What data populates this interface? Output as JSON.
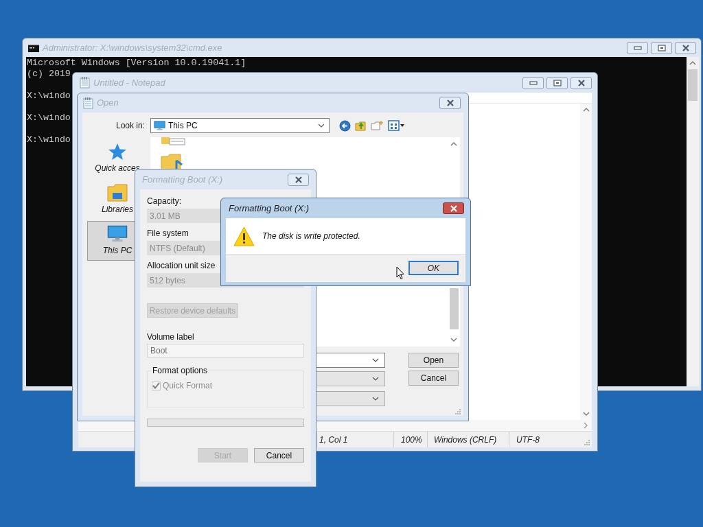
{
  "console_window": {
    "title": "Administrator: X:\\windows\\system32\\cmd.exe",
    "active": false,
    "lines": [
      {
        "kind": "output",
        "text": "Microsoft Windows [Version 10.0.19041.1]"
      },
      {
        "kind": "output",
        "text": "(c) 2019"
      },
      {
        "kind": "prompt",
        "text": "X:\\windo"
      },
      {
        "kind": "prompt",
        "text": "X:\\windo"
      },
      {
        "kind": "prompt",
        "text": "X:\\windo"
      }
    ]
  },
  "notepad_window": {
    "title": "Untitled - Notepad",
    "active": false,
    "status_bar": [
      "1, Col 1",
      "100%",
      "Windows (CRLF)",
      "UTF-8"
    ]
  },
  "open_dialog": {
    "title": "Open",
    "active": false,
    "look_in": {
      "label": "Look in:",
      "value": "This PC"
    },
    "places": [
      {
        "label": "Quick acces",
        "selected": false
      },
      {
        "label": "Libraries",
        "selected": false
      },
      {
        "label": "This PC",
        "selected": true
      }
    ],
    "buttons": [
      "Open",
      "Cancel"
    ]
  },
  "format_dialog": {
    "title": "Formatting Boot (X:)",
    "active": false,
    "fields": [
      {
        "label": "Capacity:",
        "value": "3.01 MB",
        "disabled": true
      },
      {
        "label": "File system",
        "value": "NTFS (Default)",
        "disabled": true
      },
      {
        "label": "Allocation unit size",
        "value": "512 bytes",
        "disabled": true
      }
    ],
    "restore_button": {
      "label": "Restore device defaults",
      "disabled": true
    },
    "volume_label": {
      "label": "Volume label",
      "value": "Boot",
      "disabled": true
    },
    "format_options": {
      "label": "Format options",
      "quick_format": {
        "label": "Quick Format",
        "checked": true,
        "disabled": true
      }
    },
    "progress": {
      "level": 0
    },
    "buttons": [
      {
        "label": "Start",
        "disabled": true
      },
      {
        "label": "Cancel",
        "disabled": false
      }
    ]
  },
  "message_box": {
    "title": "Formatting Boot (X:)",
    "active": true,
    "message": "The disk is write protected.",
    "button": {
      "label": "OK",
      "focused": true
    }
  }
}
